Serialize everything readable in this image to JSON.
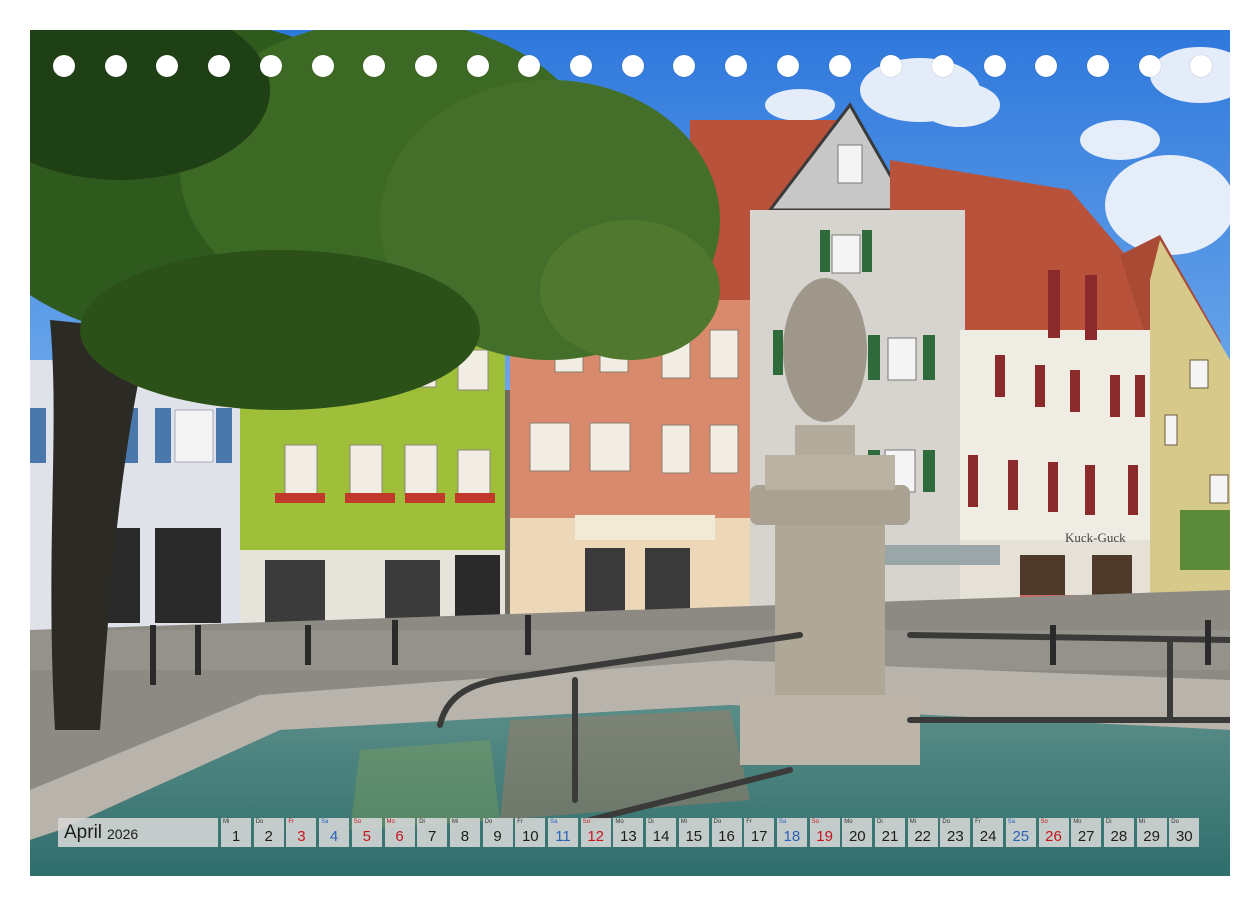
{
  "calendar": {
    "month": "April",
    "year": "2026",
    "days": [
      {
        "wd": "Mi",
        "d": "1",
        "type": "work"
      },
      {
        "wd": "Do",
        "d": "2",
        "type": "work"
      },
      {
        "wd": "Fr",
        "d": "3",
        "type": "holiday"
      },
      {
        "wd": "Sa",
        "d": "4",
        "type": "sat"
      },
      {
        "wd": "So",
        "d": "5",
        "type": "sun"
      },
      {
        "wd": "Mo",
        "d": "6",
        "type": "holiday"
      },
      {
        "wd": "Di",
        "d": "7",
        "type": "work"
      },
      {
        "wd": "Mi",
        "d": "8",
        "type": "work"
      },
      {
        "wd": "Do",
        "d": "9",
        "type": "work"
      },
      {
        "wd": "Fr",
        "d": "10",
        "type": "work"
      },
      {
        "wd": "Sa",
        "d": "11",
        "type": "sat"
      },
      {
        "wd": "So",
        "d": "12",
        "type": "sun"
      },
      {
        "wd": "Mo",
        "d": "13",
        "type": "work"
      },
      {
        "wd": "Di",
        "d": "14",
        "type": "work"
      },
      {
        "wd": "Mi",
        "d": "15",
        "type": "work"
      },
      {
        "wd": "Do",
        "d": "16",
        "type": "work"
      },
      {
        "wd": "Fr",
        "d": "17",
        "type": "work"
      },
      {
        "wd": "Sa",
        "d": "18",
        "type": "sat"
      },
      {
        "wd": "So",
        "d": "19",
        "type": "sun"
      },
      {
        "wd": "Mo",
        "d": "20",
        "type": "work"
      },
      {
        "wd": "Di",
        "d": "21",
        "type": "work"
      },
      {
        "wd": "Mi",
        "d": "22",
        "type": "work"
      },
      {
        "wd": "Do",
        "d": "23",
        "type": "work"
      },
      {
        "wd": "Fr",
        "d": "24",
        "type": "work"
      },
      {
        "wd": "Sa",
        "d": "25",
        "type": "sat"
      },
      {
        "wd": "So",
        "d": "26",
        "type": "sun"
      },
      {
        "wd": "Mo",
        "d": "27",
        "type": "work"
      },
      {
        "wd": "Di",
        "d": "28",
        "type": "work"
      },
      {
        "wd": "Mi",
        "d": "29",
        "type": "work"
      },
      {
        "wd": "Do",
        "d": "30",
        "type": "work"
      }
    ]
  },
  "photo": {
    "sign_text": "Kuck-Guck"
  },
  "colors": {
    "sky": "#3f86e0",
    "tree": "#2f5a1e",
    "green_house": "#9fbf3a",
    "salmon_house": "#d98a6c",
    "roof": "#b8523a",
    "water": "#4c8a86",
    "saturday": "#2a62b5",
    "sunday": "#c4161c"
  }
}
